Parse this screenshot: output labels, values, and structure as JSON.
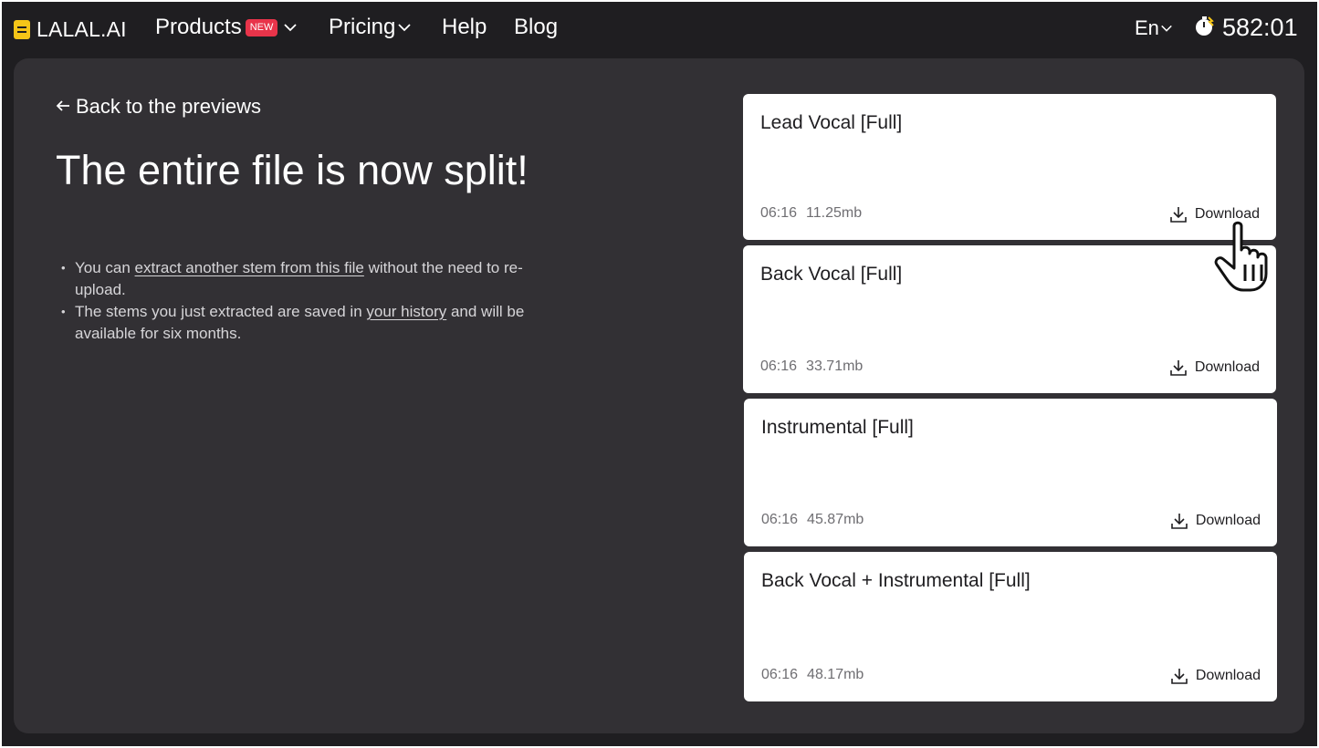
{
  "nav": {
    "logo": "LALAL.AI",
    "products": "Products",
    "new_badge": "NEW",
    "pricing": "Pricing",
    "help": "Help",
    "blog": "Blog",
    "language": "En",
    "timer": "582:01"
  },
  "main": {
    "back_link": "Back to the previews",
    "headline": "The entire file is now split!",
    "notes": {
      "n1_pre": "You can ",
      "n1_link": "extract another stem from this file",
      "n1_post": " without the need to re-upload.",
      "n2_pre": "The stems you just extracted are saved in ",
      "n2_link": "your history",
      "n2_post": " and will be available for six months."
    }
  },
  "stems": [
    {
      "title": "Lead Vocal [Full]",
      "duration": "06:16",
      "size": "11.25mb",
      "download": "Download"
    },
    {
      "title": "Back Vocal [Full]",
      "duration": "06:16",
      "size": "33.71mb",
      "download": "Download"
    },
    {
      "title": "Instrumental [Full]",
      "duration": "06:16",
      "size": "45.87mb",
      "download": "Download"
    },
    {
      "title": "Back Vocal + Instrumental [Full]",
      "duration": "06:16",
      "size": "48.17mb",
      "download": "Download"
    }
  ],
  "colors": {
    "background": "#1f1e21",
    "panel": "#323034",
    "card": "#ffffff",
    "badge": "#e8344a",
    "logo": "#f5c518"
  },
  "icons": [
    "logo-icon",
    "chevron-down-icon",
    "stopwatch-icon",
    "arrow-left-icon",
    "download-icon",
    "hand-pointer-icon"
  ]
}
